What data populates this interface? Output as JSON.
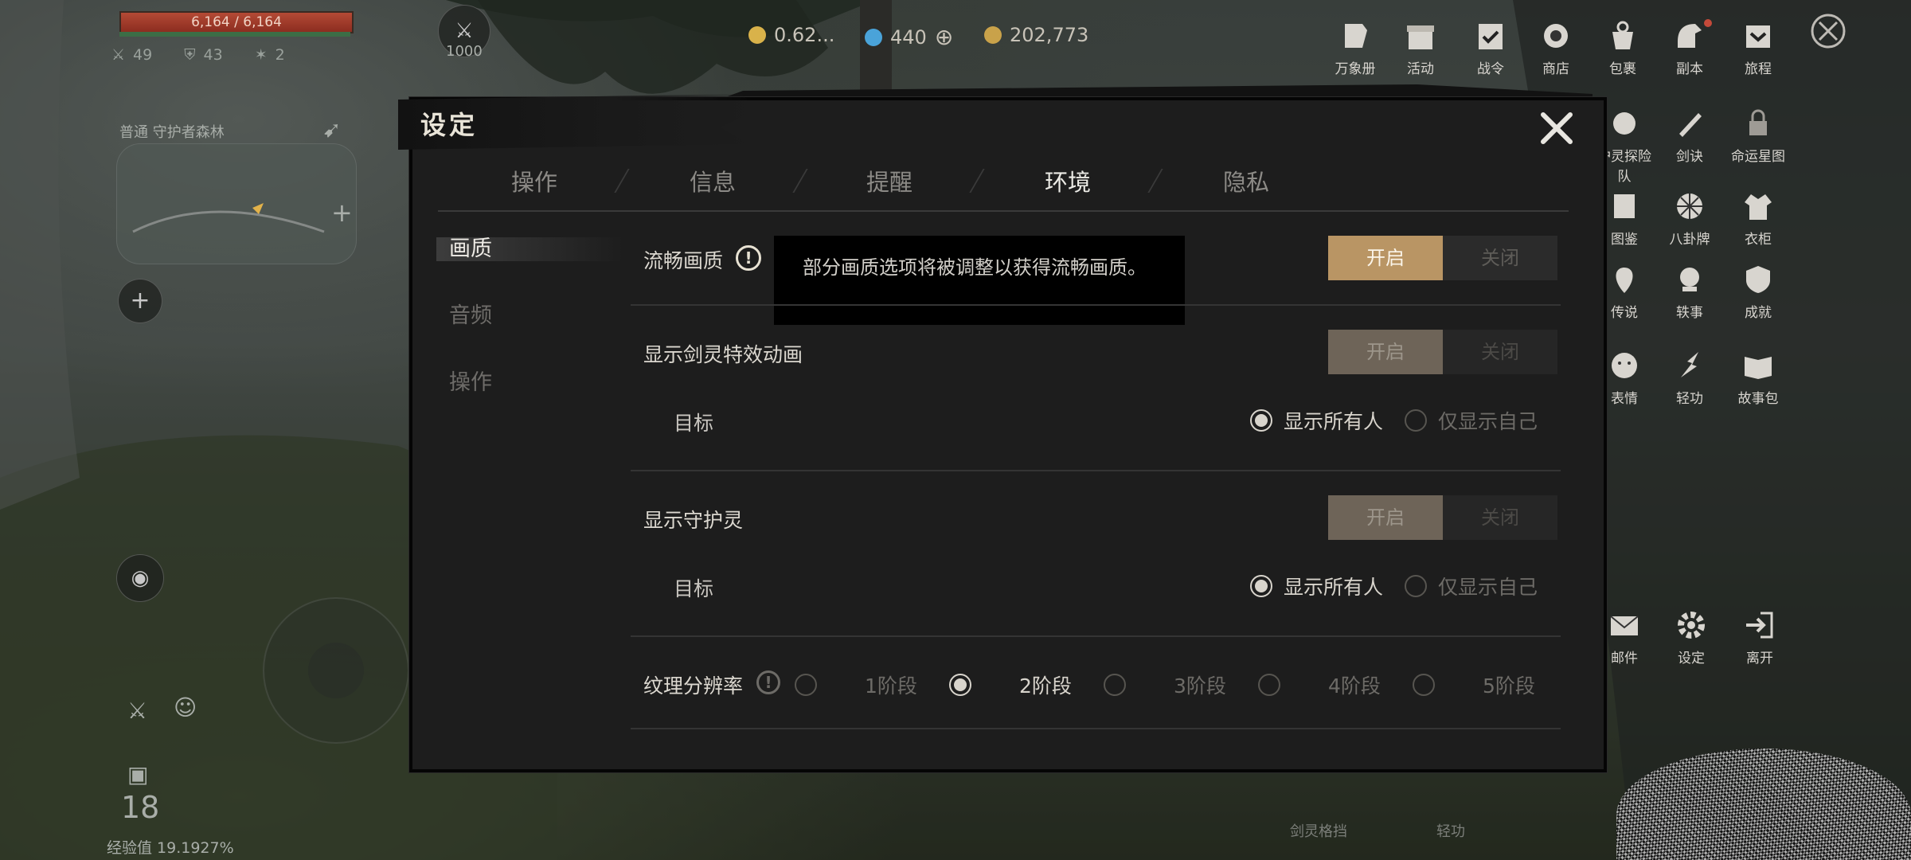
{
  "hud": {
    "hp_text": "6,164 / 6,164",
    "attack": "49",
    "defense": "43",
    "crit": "2",
    "level_badge": "1000",
    "location": "普通  守护者森林",
    "level": "18",
    "exp_text": "经验值 19.1927%"
  },
  "currencies": [
    {
      "value": "0.62...",
      "color": "#d9b24a"
    },
    {
      "value": "440",
      "color": "#4aa3d9"
    },
    {
      "value": "202,773",
      "color": "#d9b24a"
    }
  ],
  "right_menu": {
    "row1": [
      "万象册",
      "活动",
      "战令",
      "商店",
      "包裹",
      "副本",
      "旅程"
    ],
    "row2": [
      "护灵探险队",
      "剑诀",
      "命运星图"
    ],
    "row3": [
      "图鉴",
      "八卦牌",
      "衣柜"
    ],
    "row4": [
      "传说",
      "轶事",
      "成就"
    ],
    "row5": [
      "表情",
      "轻功",
      "故事包"
    ],
    "row6": [
      "邮件",
      "设定",
      "离开"
    ]
  },
  "settings": {
    "title": "设定",
    "tabs": [
      "操作",
      "信息",
      "提醒",
      "环境",
      "隐私"
    ],
    "active_tab": "环境",
    "side_items": [
      "画质",
      "音频",
      "操作"
    ],
    "active_side": "画质",
    "smooth_quality": {
      "label": "流畅画质",
      "info": "!",
      "on": "开启",
      "off": "关闭",
      "tooltip": "部分画质选项将被调整以获得流畅画质。"
    },
    "sword_effect": {
      "label": "显示剑灵特效动画",
      "on": "开启",
      "off": "关闭",
      "target_label": "目标",
      "option_all": "显示所有人",
      "option_self": "仅显示自己"
    },
    "guardian": {
      "label": "显示守护灵",
      "on": "开启",
      "off": "关闭",
      "target_label": "目标",
      "option_all": "显示所有人",
      "option_self": "仅显示自己"
    },
    "texture": {
      "label": "纹理分辨率",
      "info": "!",
      "options": [
        "1阶段",
        "2阶段",
        "3阶段",
        "4阶段",
        "5阶段"
      ],
      "selected": "2阶段"
    }
  },
  "bottom": {
    "label1": "剑灵格挡",
    "label2": "轻功"
  }
}
